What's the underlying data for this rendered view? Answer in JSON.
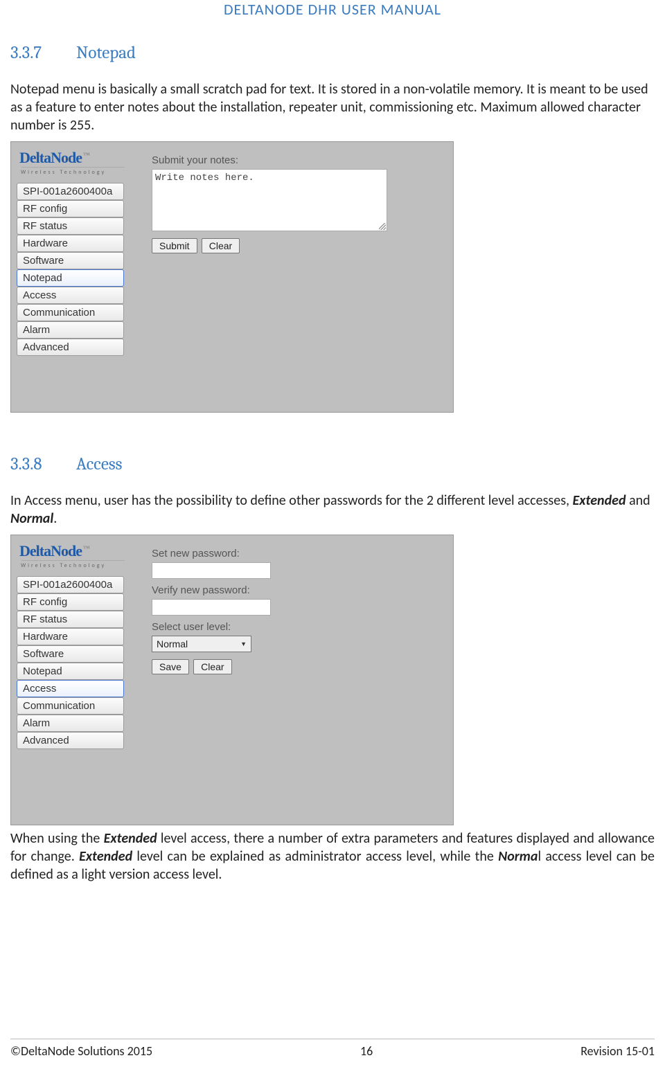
{
  "header": "DELTANODE DHR USER MANUAL",
  "sec1": {
    "num": "3.3.7",
    "title": "Notepad",
    "para": "Notepad menu is basically a small scratch pad for text. It is stored in a non-volatile memory. It is meant to be used as a feature to enter notes about the installation, repeater unit, commissioning etc. Maximum allowed character number is 255."
  },
  "shot1": {
    "logo_top": "DeltaNode",
    "logo_sub": "Wireless   Technology",
    "nav": [
      "SPI-001a2600400a",
      "RF config",
      "RF status",
      "Hardware",
      "Software",
      "Notepad",
      "Access",
      "Communication",
      "Alarm",
      "Advanced"
    ],
    "active_index": 5,
    "notes_label": "Submit your notes:",
    "notes_text": "Write notes here.",
    "btn_submit": "Submit",
    "btn_clear": "Clear"
  },
  "sec2": {
    "num": "3.3.8",
    "title": "Access",
    "para_pre": "In Access menu, user has the possibility to define other passwords for the 2 different level accesses, ",
    "para_ext": "Extended",
    "para_and": " and ",
    "para_norm": "Normal",
    "para_dot": "."
  },
  "shot2": {
    "logo_top": "DeltaNode",
    "logo_sub": "Wireless   Technology",
    "nav": [
      "SPI-001a2600400a",
      "RF config",
      "RF status",
      "Hardware",
      "Software",
      "Notepad",
      "Access",
      "Communication",
      "Alarm",
      "Advanced"
    ],
    "active_index": 6,
    "label_new": "Set new password:",
    "label_verify": "Verify new password:",
    "label_level": "Select user level:",
    "select_value": "Normal",
    "btn_save": "Save",
    "btn_clear": "Clear"
  },
  "closing": {
    "t1": "When using the ",
    "ext1": "Extended",
    "t2": " level access, there a number of extra parameters and features displayed and allowance for change. ",
    "ext2": "Extended",
    "t3": " level can be explained as administrator access level, while the ",
    "norm": "Norma",
    "t4": "l access level can be defined as a light version access level."
  },
  "footer": {
    "left": "©DeltaNode Solutions 2015",
    "center": "16",
    "right": "Revision 15-01"
  }
}
